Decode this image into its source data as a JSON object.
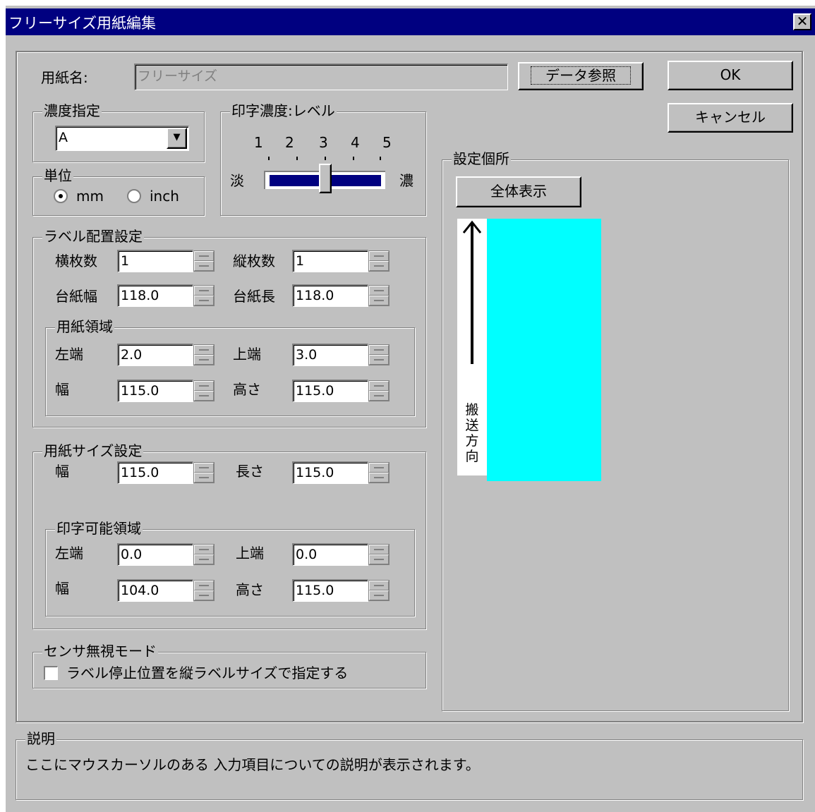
{
  "window": {
    "title": "フリーサイズ用紙編集",
    "close_glyph": "✕"
  },
  "paper_name": {
    "label": "用紙名:",
    "value": "フリーサイズ",
    "data_ref_button": "データ参照"
  },
  "buttons": {
    "ok": "OK",
    "cancel": "キャンセル"
  },
  "density": {
    "group": "濃度指定",
    "value": "A"
  },
  "print_density": {
    "group": "印字濃度:レベル",
    "ticks": [
      "1",
      "2",
      "3",
      "4",
      "5"
    ],
    "low": "淡",
    "high": "濃",
    "level": 3
  },
  "units": {
    "group": "単位",
    "mm": "mm",
    "inch": "inch",
    "selected": "mm"
  },
  "label_layout": {
    "group": "ラベル配置設定",
    "h_count_label": "横枚数",
    "h_count": "1",
    "v_count_label": "縦枚数",
    "v_count": "1",
    "mount_width_label": "台紙幅",
    "mount_width": "118.0",
    "mount_length_label": "台紙長",
    "mount_length": "118.0",
    "paper_area": {
      "group": "用紙領域",
      "left_label": "左端",
      "left": "2.0",
      "top_label": "上端",
      "top": "3.0",
      "width_label": "幅",
      "width": "115.0",
      "height_label": "高さ",
      "height": "115.0"
    }
  },
  "paper_size": {
    "group": "用紙サイズ設定",
    "width_label": "幅",
    "width": "115.0",
    "length_label": "長さ",
    "length": "115.0",
    "printable": {
      "group": "印字可能領域",
      "left_label": "左端",
      "left": "0.0",
      "top_label": "上端",
      "top": "0.0",
      "width_label": "幅",
      "width": "104.0",
      "height_label": "高さ",
      "height": "115.0"
    }
  },
  "sensor": {
    "group": "センサ無視モード",
    "checkbox": "ラベル停止位置を縦ラベルサイズで指定する",
    "checked": false
  },
  "preview": {
    "group": "設定個所",
    "show_all_button": "全体表示",
    "feed_direction": [
      "搬",
      "送",
      "方",
      "向"
    ],
    "label_color": "#00ffff"
  },
  "description": {
    "group": "説明",
    "text": "ここにマウスカーソルのある 入力項目についての説明が表示されます。"
  }
}
